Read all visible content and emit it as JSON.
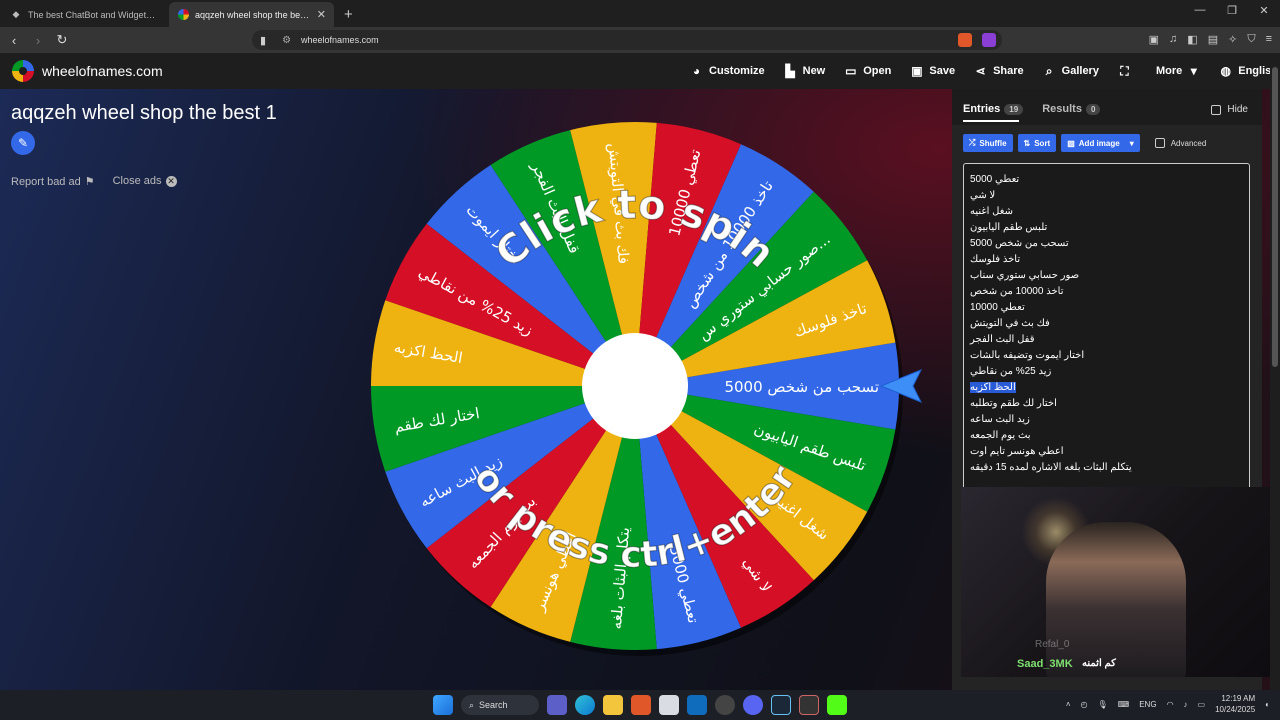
{
  "browser": {
    "tabs": [
      {
        "title": "The best ChatBot and Widgets for Ki",
        "icon": "diamond-icon"
      },
      {
        "title": "aqqzeh wheel shop the best 1",
        "icon": "wheel-favicon-icon"
      }
    ],
    "url": "wheelofnames.com"
  },
  "site": {
    "brand": "wheelofnames.com",
    "menu": [
      {
        "label": "Customize",
        "icon": "palette-icon"
      },
      {
        "label": "New",
        "icon": "file-icon"
      },
      {
        "label": "Open",
        "icon": "folder-icon"
      },
      {
        "label": "Save",
        "icon": "save-icon"
      },
      {
        "label": "Share",
        "icon": "share-icon"
      },
      {
        "label": "Gallery",
        "icon": "search-icon"
      },
      {
        "label": "",
        "icon": "fullscreen-icon"
      },
      {
        "label": "More",
        "icon": "chevron-down-icon"
      },
      {
        "label": "English",
        "icon": "globe-icon"
      }
    ]
  },
  "wheel": {
    "title": "aqqzeh wheel shop the best 1",
    "report_ad": "Report bad ad",
    "close_ads": "Close ads",
    "click_to_spin": "Click to spin",
    "press_key": "or press ctrl+enter",
    "colors": [
      "#3369e8",
      "#009925",
      "#eeb211",
      "#d50f25"
    ],
    "segment_labels": [
      "تسحب من شخص 5000",
      "تلبس طقم اليابيون",
      "شغل اغنيه",
      "لا شي",
      "تعطي 5000",
      "يتكلم البثات بلغه",
      "اعطي هونسر",
      "بث يوم الجمعه",
      "زيد البث ساعه",
      "اختار لك طقم",
      "الحظ اكزبه",
      "زيد 25% من نقاطي",
      "اختار ايموت",
      "قفل البث الفجر",
      "فك بث في التويتش",
      "تعطي 10000",
      "تاخذ 10000 من شخص",
      "صور حسابي ستوري س...",
      "تاخذ فلوسك"
    ]
  },
  "sidebar": {
    "tab_entries": "Entries",
    "entries_count": "19",
    "tab_results": "Results",
    "results_count": "0",
    "hide": "Hide",
    "buttons": {
      "shuffle": "Shuffle",
      "sort": "Sort",
      "add_image": "Add image",
      "advanced": "Advanced"
    },
    "entries": [
      "تعطي 5000",
      "لا شي",
      "شغل اغنيه",
      "تلبس طقم اليابيون",
      "تسحب من شخص 5000",
      "تاخذ فلوسك",
      "صور حسابي ستوري سناب",
      "تاخذ 10000 من شخص",
      "تعطي 10000",
      "فك بث في التويتش",
      "قفل البث الفجر",
      "اختار ايموت وتضيفه بالشات",
      "زيد 25% من نقاطي",
      "الحظ اكزبه",
      "اختار لك طقم وتطلبه",
      "زيد البث ساعه",
      "بث يوم الجمعه",
      "اعطي هونسر تايم اوت",
      "يتكلم البثات بلغه الاشاره لمده 15 دقيقه"
    ],
    "selected_index": 13
  },
  "webcam": {
    "username": "Saad_3MK",
    "message": "كم اثمنه",
    "faint_text": "Refal_0"
  },
  "taskbar": {
    "search": "Search",
    "lang": "ENG",
    "time": "12:19 AM",
    "date": "10/24/2025"
  }
}
